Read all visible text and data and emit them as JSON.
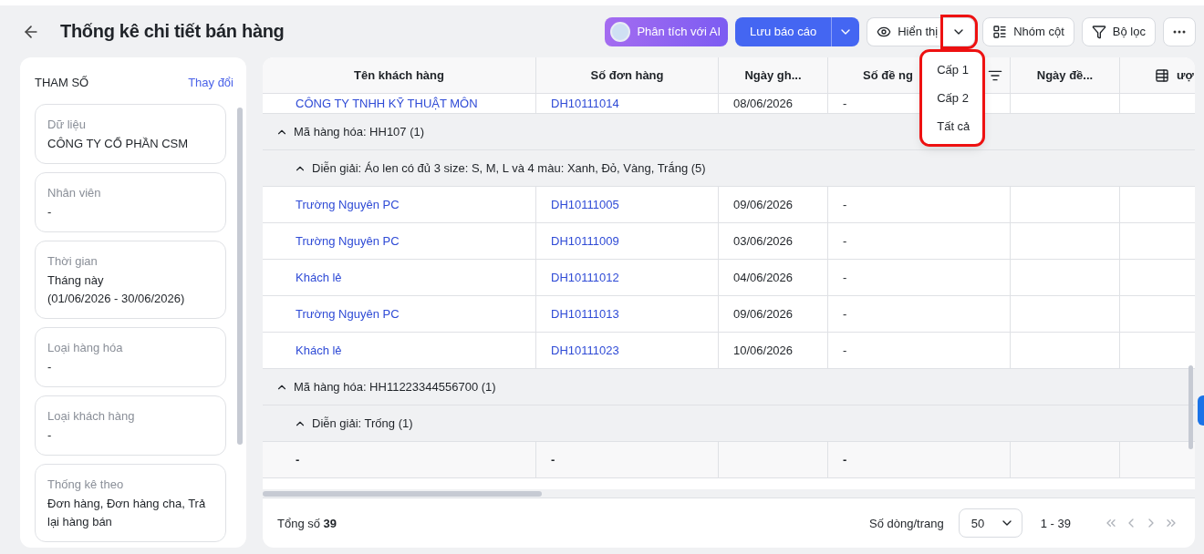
{
  "header": {
    "title": "Thống kê chi tiết bán hàng",
    "ai_button": "Phân tích với AI",
    "save_button": "Lưu báo cáo",
    "display_button": "Hiển thị",
    "display_caret_highlighted": true,
    "group_button": "Nhóm cột",
    "filter_button": "Bộ lọc"
  },
  "display_menu": {
    "highlighted": true,
    "items": [
      {
        "label": "Cấp 1",
        "selected": false
      },
      {
        "label": "Cấp 2",
        "selected": false
      },
      {
        "label": "Tất cả",
        "selected": false
      }
    ]
  },
  "sidebar": {
    "title": "THAM SỐ",
    "action": "Thay đổi",
    "params": [
      {
        "label": "Dữ liệu",
        "value": "CÔNG TY CỔ PHẦN CSM"
      },
      {
        "label": "Nhân viên",
        "value": "-"
      },
      {
        "label": "Thời gian",
        "value": "Tháng này\n(01/06/2026 - 30/06/2026)"
      },
      {
        "label": "Loại hàng hóa",
        "value": "-"
      },
      {
        "label": "Loại khách hàng",
        "value": "-"
      },
      {
        "label": "Thống kê theo",
        "value": "Đơn hàng, Đơn hàng cha, Trả lại hàng bán"
      }
    ]
  },
  "table": {
    "columns": [
      {
        "label": "Tên khách hàng",
        "kind": "text"
      },
      {
        "label": "Số đơn hàng",
        "kind": "text"
      },
      {
        "label": "Ngày gh...",
        "kind": "text"
      },
      {
        "label": "Số đề ng",
        "kind": "filter"
      },
      {
        "label": "Ngày đề...",
        "kind": "text"
      },
      {
        "label": "ượ",
        "kind": "add"
      }
    ],
    "rows": [
      {
        "kind": "data",
        "cells": [
          "CÔNG TY TNHH KỸ THUẬT MÔN",
          "DH10111014",
          "08/06/2026",
          "-",
          "",
          ""
        ]
      },
      {
        "kind": "group",
        "label": "Mã hàng hóa: HH107 (1)",
        "expanded": true
      },
      {
        "kind": "subgroup",
        "label": "Diễn giải: Áo len có đủ 3 size: S, M, L và 4 màu: Xanh, Đỏ, Vàng, Trắng (5)",
        "expanded": true
      },
      {
        "kind": "data",
        "cells": [
          "Trường Nguyên PC",
          "DH10111005",
          "09/06/2026",
          "-",
          "",
          ""
        ]
      },
      {
        "kind": "data",
        "cells": [
          "Trường Nguyên PC",
          "DH10111009",
          "03/06/2026",
          "-",
          "",
          ""
        ]
      },
      {
        "kind": "data",
        "cells": [
          "Khách lẻ",
          "DH10111012",
          "04/06/2026",
          "-",
          "",
          ""
        ]
      },
      {
        "kind": "data",
        "cells": [
          "Trường Nguyên PC",
          "DH10111013",
          "09/06/2026",
          "-",
          "",
          ""
        ]
      },
      {
        "kind": "data",
        "cells": [
          "Khách lẻ",
          "DH10111023",
          "10/06/2026",
          "-",
          "",
          ""
        ]
      },
      {
        "kind": "group",
        "label": "Mã hàng hóa: HH11223344556700 (1)",
        "expanded": true
      },
      {
        "kind": "subgroup",
        "label": "Diễn giải: Trống (1)",
        "expanded": true
      },
      {
        "kind": "total",
        "cells": [
          "-",
          "-",
          "",
          "-",
          "",
          ""
        ]
      }
    ]
  },
  "footer": {
    "total": "Tổng số **39**",
    "rows_label": "Số dòng/trang",
    "page_size": "50",
    "range": "1 - 39"
  }
}
